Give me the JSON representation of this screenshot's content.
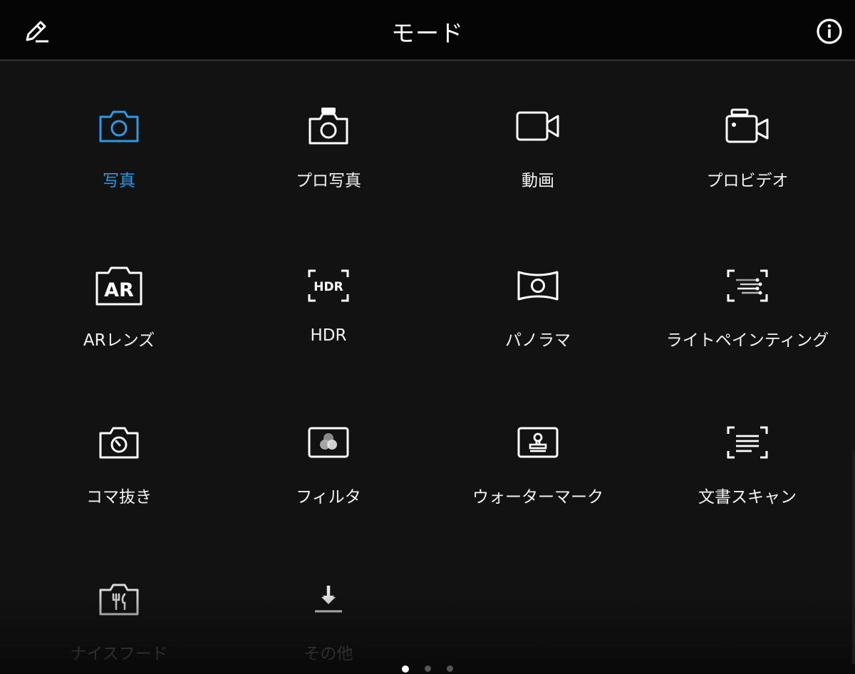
{
  "header": {
    "title": "モード",
    "edit_icon": "pencil-icon",
    "info_icon": "info-icon"
  },
  "colors": {
    "background": "#121212",
    "header_background": "#050505",
    "accent": "#2e9ae6",
    "label": "#f2f2f2",
    "dim_label": "#6a6a6a"
  },
  "modes": [
    {
      "label": "写真",
      "icon": "camera-icon",
      "active": true
    },
    {
      "label": "プロ写真",
      "icon": "pro-camera-icon"
    },
    {
      "label": "動画",
      "icon": "video-camera-icon"
    },
    {
      "label": "プロビデオ",
      "icon": "pro-video-icon"
    },
    {
      "label": "ARレンズ",
      "icon": "ar-lens-icon"
    },
    {
      "label": "HDR",
      "icon": "hdr-icon"
    },
    {
      "label": "パノラマ",
      "icon": "panorama-icon"
    },
    {
      "label": "ライトペインティング",
      "icon": "light-painting-icon"
    },
    {
      "label": "コマ抜き",
      "icon": "time-lapse-icon"
    },
    {
      "label": "フィルタ",
      "icon": "filter-icon"
    },
    {
      "label": "ウォーターマーク",
      "icon": "watermark-icon"
    },
    {
      "label": "文書スキャン",
      "icon": "document-scan-icon"
    },
    {
      "label": "ナイスフード",
      "icon": "good-food-icon"
    },
    {
      "label": "その他",
      "icon": "download-more-icon"
    }
  ],
  "pagination": {
    "pages": 3,
    "current": 1
  }
}
